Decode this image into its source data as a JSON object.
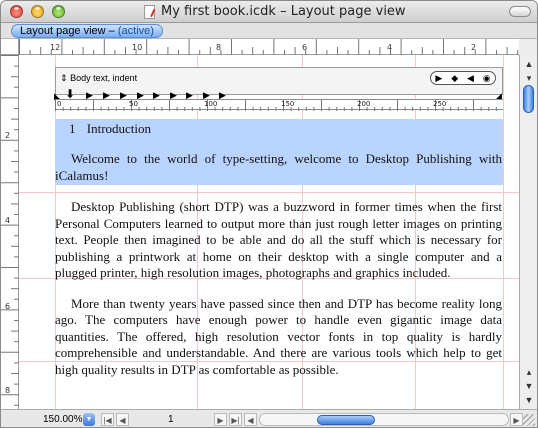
{
  "window": {
    "title": "My first book.icdk – Layout page view"
  },
  "tabs": [
    {
      "label": "Layout page view –",
      "status": "(active)",
      "selected": true
    }
  ],
  "hruler": {
    "labels": [
      "12",
      "10",
      "8",
      "6",
      "4",
      "2"
    ]
  },
  "vruler": {
    "labels": [
      "2",
      "4",
      "6",
      "8"
    ]
  },
  "text_frame": {
    "paragraph_style": "Body text, indent",
    "ruler_labels": [
      "0",
      "50",
      "100",
      "150",
      "200",
      "250"
    ],
    "alignment_icons": [
      "play-icon",
      "diamond-icon",
      "reverse-play-icon",
      "circle-dot-icon"
    ]
  },
  "document": {
    "heading_number": "1",
    "heading_text": "Introduction",
    "paragraphs": [
      "Welcome to the world of type-setting, welcome to Desktop Publishing with iCalamus!",
      "Desktop Publishing (short DTP) was a buzzword in former times when the first Personal Computers learned to output more than just rough letter images on printing text. People then imagined to be able and do all the stuff which is necessary for publishing a printwork at home on their desktop with a single computer and a plugged printer, high resolution images, photographs and graphics included.",
      "More than twenty years have passed since then and DTP has become reality long ago. The computers have enough power to handle even gigantic image data quantities. The offered, high resolution vector fonts in top quality is hardly comprehensible and understandable. And there are various tools which help to get high quality results in DTP as comfortable as possible."
    ]
  },
  "statusbar": {
    "zoom": "150.00%",
    "page": "1"
  },
  "colors": {
    "selection": "#b9d4ff",
    "guide": "#f1c7c7",
    "tab_active": "#79aef0"
  }
}
